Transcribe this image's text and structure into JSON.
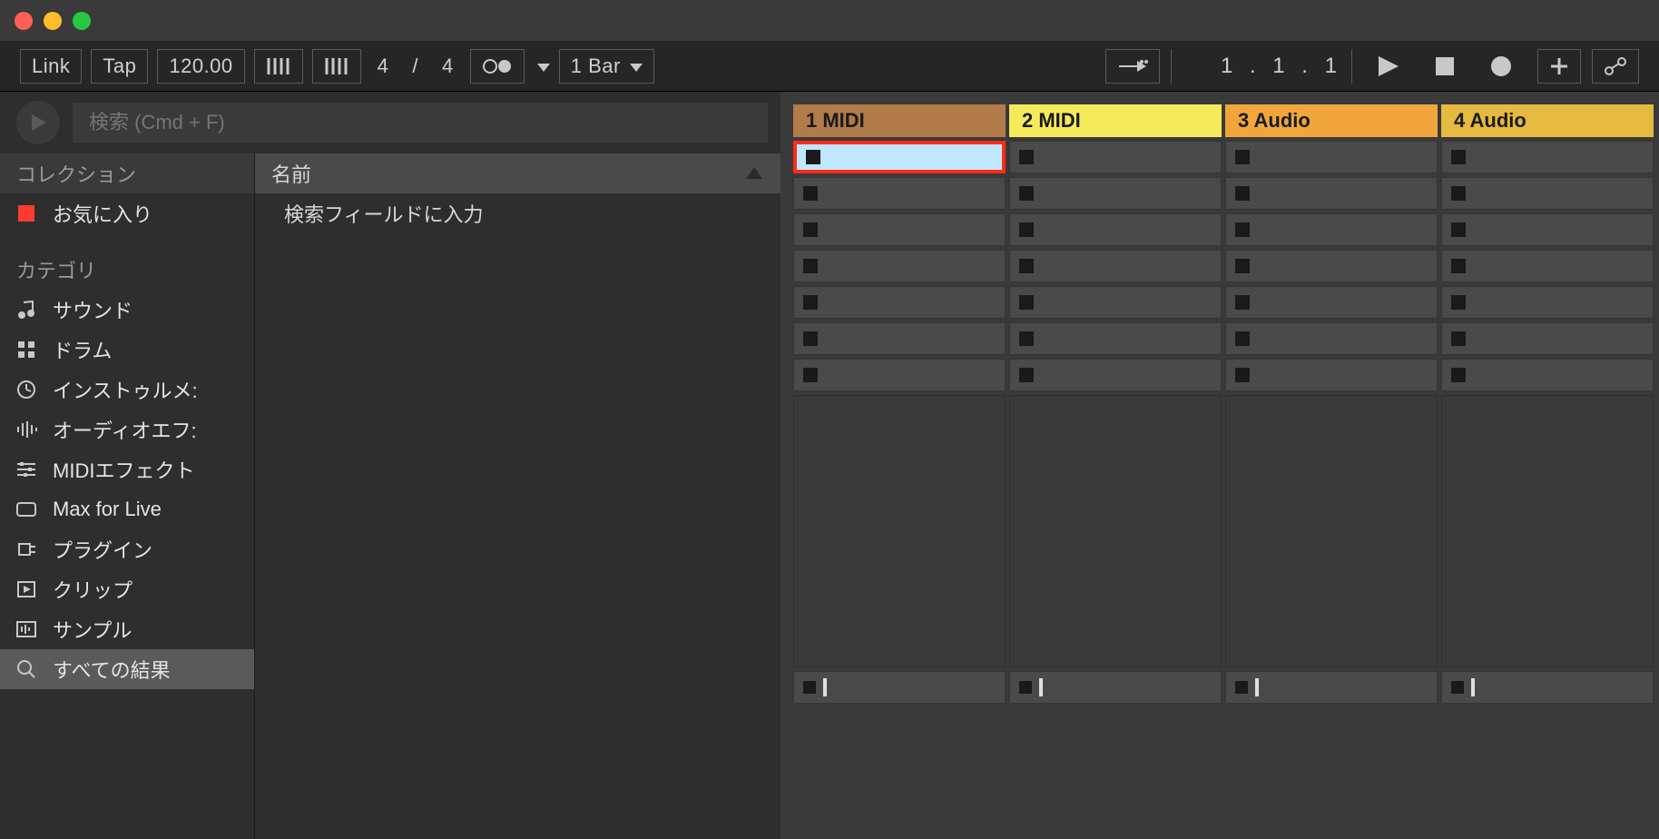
{
  "toolbar": {
    "link_label": "Link",
    "tap_label": "Tap",
    "tempo": "120.00",
    "sig_num": "4",
    "sig_den": "4",
    "sig_sep": "/",
    "quantize": "1 Bar",
    "position": "1 .   1 .   1"
  },
  "browser": {
    "search_placeholder": "検索 (Cmd + F)",
    "collection_label": "コレクション",
    "favorites_label": "お気に入り",
    "name_header": "名前",
    "search_hint": "検索フィールドに入力",
    "category_label": "カテゴリ",
    "categories": [
      {
        "label": "サウンド",
        "icon": "note-icon"
      },
      {
        "label": "ドラム",
        "icon": "grid-icon"
      },
      {
        "label": "インストゥルメ:",
        "icon": "clock-icon"
      },
      {
        "label": "オーディオエフ:",
        "icon": "wave-icon"
      },
      {
        "label": "MIDIエフェクト",
        "icon": "sliders-icon"
      },
      {
        "label": "Max for Live",
        "icon": "rect-icon"
      },
      {
        "label": "プラグイン",
        "icon": "plug-icon"
      },
      {
        "label": "クリップ",
        "icon": "play-rect-icon"
      },
      {
        "label": "サンプル",
        "icon": "sample-icon"
      }
    ],
    "all_results_label": "すべての結果"
  },
  "tracks": [
    {
      "label": "1 MIDI",
      "color": "th-c0"
    },
    {
      "label": "2 MIDI",
      "color": "th-c1"
    },
    {
      "label": "3 Audio",
      "color": "th-c2"
    },
    {
      "label": "4 Audio",
      "color": "th-c3"
    }
  ],
  "clip_rows": 7,
  "highlight": {
    "track": 0,
    "row": 0
  }
}
